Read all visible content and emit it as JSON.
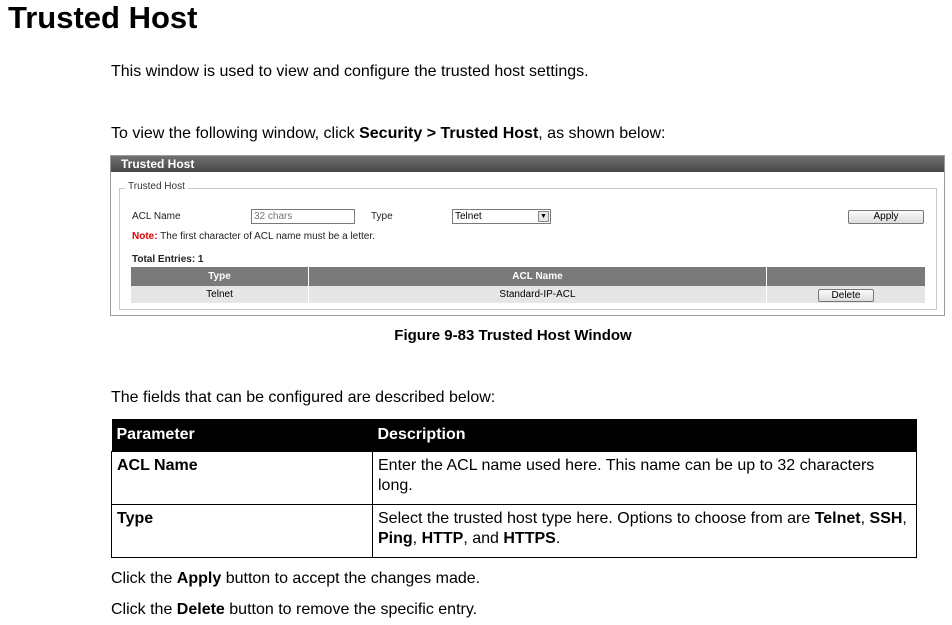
{
  "page": {
    "title": "Trusted Host",
    "intro": "This window is used to view and configure the trusted host settings.",
    "nav_prefix": "To view the following window, click ",
    "nav_path": "Security > Trusted Host",
    "nav_suffix": ", as shown below:",
    "figure_caption": "Figure 9-83 Trusted Host Window",
    "fields_intro": "The fields that can be configured are described below:",
    "apply_prefix": "Click the ",
    "apply_word": "Apply",
    "apply_suffix": " button to accept the changes made.",
    "delete_prefix": "Click the ",
    "delete_word": "Delete",
    "delete_suffix": " button to remove the specific entry."
  },
  "screenshot": {
    "window_title": "Trusted Host",
    "fieldset_legend": "Trusted Host",
    "acl_name_label": "ACL Name",
    "acl_name_placeholder": "32 chars",
    "type_label": "Type",
    "type_selected": "Telnet",
    "apply_label": "Apply",
    "note_label": "Note:",
    "note_text": "The first character of ACL name must be a letter.",
    "total_entries": "Total Entries: 1",
    "columns": [
      "Type",
      "ACL Name",
      ""
    ],
    "rows": [
      {
        "type": "Telnet",
        "acl_name": "Standard-IP-ACL",
        "action": "Delete"
      }
    ]
  },
  "param_table": {
    "headers": [
      "Parameter",
      "Description"
    ],
    "rows": [
      {
        "param": "ACL Name",
        "desc": "Enter the ACL name used here. This name can be up to 32 characters long."
      },
      {
        "param": "Type",
        "desc_prefix": "Select the trusted host type here. Options to choose from are ",
        "opt1": "Telnet",
        "sep1": ", ",
        "opt2": "SSH",
        "sep2": ", ",
        "opt3": "Ping",
        "sep3": ", ",
        "opt4": "HTTP",
        "sep4": ", and ",
        "opt5": "HTTPS",
        "desc_suffix": "."
      }
    ]
  }
}
